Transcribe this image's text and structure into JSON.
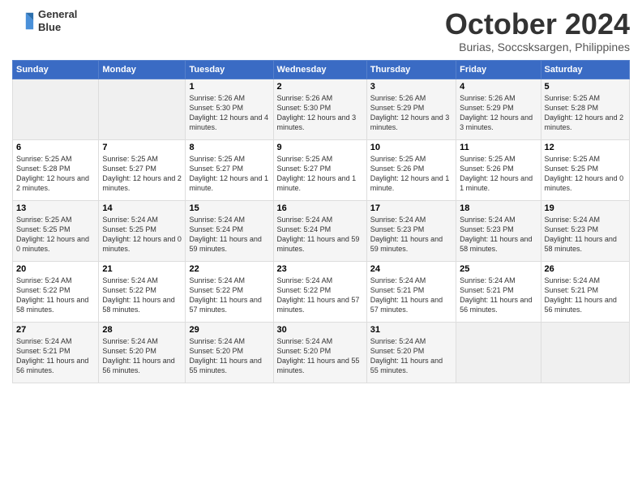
{
  "logo": {
    "line1": "General",
    "line2": "Blue"
  },
  "title": "October 2024",
  "subtitle": "Burias, Soccsksargen, Philippines",
  "headers": [
    "Sunday",
    "Monday",
    "Tuesday",
    "Wednesday",
    "Thursday",
    "Friday",
    "Saturday"
  ],
  "weeks": [
    [
      {
        "day": "",
        "empty": true
      },
      {
        "day": "",
        "empty": true
      },
      {
        "day": "1",
        "sunrise": "5:26 AM",
        "sunset": "5:30 PM",
        "daylight": "12 hours and 4 minutes."
      },
      {
        "day": "2",
        "sunrise": "5:26 AM",
        "sunset": "5:30 PM",
        "daylight": "12 hours and 3 minutes."
      },
      {
        "day": "3",
        "sunrise": "5:26 AM",
        "sunset": "5:29 PM",
        "daylight": "12 hours and 3 minutes."
      },
      {
        "day": "4",
        "sunrise": "5:26 AM",
        "sunset": "5:29 PM",
        "daylight": "12 hours and 3 minutes."
      },
      {
        "day": "5",
        "sunrise": "5:25 AM",
        "sunset": "5:28 PM",
        "daylight": "12 hours and 2 minutes."
      }
    ],
    [
      {
        "day": "6",
        "sunrise": "5:25 AM",
        "sunset": "5:28 PM",
        "daylight": "12 hours and 2 minutes."
      },
      {
        "day": "7",
        "sunrise": "5:25 AM",
        "sunset": "5:27 PM",
        "daylight": "12 hours and 2 minutes."
      },
      {
        "day": "8",
        "sunrise": "5:25 AM",
        "sunset": "5:27 PM",
        "daylight": "12 hours and 1 minute."
      },
      {
        "day": "9",
        "sunrise": "5:25 AM",
        "sunset": "5:27 PM",
        "daylight": "12 hours and 1 minute."
      },
      {
        "day": "10",
        "sunrise": "5:25 AM",
        "sunset": "5:26 PM",
        "daylight": "12 hours and 1 minute."
      },
      {
        "day": "11",
        "sunrise": "5:25 AM",
        "sunset": "5:26 PM",
        "daylight": "12 hours and 1 minute."
      },
      {
        "day": "12",
        "sunrise": "5:25 AM",
        "sunset": "5:25 PM",
        "daylight": "12 hours and 0 minutes."
      }
    ],
    [
      {
        "day": "13",
        "sunrise": "5:25 AM",
        "sunset": "5:25 PM",
        "daylight": "12 hours and 0 minutes."
      },
      {
        "day": "14",
        "sunrise": "5:24 AM",
        "sunset": "5:25 PM",
        "daylight": "12 hours and 0 minutes."
      },
      {
        "day": "15",
        "sunrise": "5:24 AM",
        "sunset": "5:24 PM",
        "daylight": "11 hours and 59 minutes."
      },
      {
        "day": "16",
        "sunrise": "5:24 AM",
        "sunset": "5:24 PM",
        "daylight": "11 hours and 59 minutes."
      },
      {
        "day": "17",
        "sunrise": "5:24 AM",
        "sunset": "5:23 PM",
        "daylight": "11 hours and 59 minutes."
      },
      {
        "day": "18",
        "sunrise": "5:24 AM",
        "sunset": "5:23 PM",
        "daylight": "11 hours and 58 minutes."
      },
      {
        "day": "19",
        "sunrise": "5:24 AM",
        "sunset": "5:23 PM",
        "daylight": "11 hours and 58 minutes."
      }
    ],
    [
      {
        "day": "20",
        "sunrise": "5:24 AM",
        "sunset": "5:22 PM",
        "daylight": "11 hours and 58 minutes."
      },
      {
        "day": "21",
        "sunrise": "5:24 AM",
        "sunset": "5:22 PM",
        "daylight": "11 hours and 58 minutes."
      },
      {
        "day": "22",
        "sunrise": "5:24 AM",
        "sunset": "5:22 PM",
        "daylight": "11 hours and 57 minutes."
      },
      {
        "day": "23",
        "sunrise": "5:24 AM",
        "sunset": "5:22 PM",
        "daylight": "11 hours and 57 minutes."
      },
      {
        "day": "24",
        "sunrise": "5:24 AM",
        "sunset": "5:21 PM",
        "daylight": "11 hours and 57 minutes."
      },
      {
        "day": "25",
        "sunrise": "5:24 AM",
        "sunset": "5:21 PM",
        "daylight": "11 hours and 56 minutes."
      },
      {
        "day": "26",
        "sunrise": "5:24 AM",
        "sunset": "5:21 PM",
        "daylight": "11 hours and 56 minutes."
      }
    ],
    [
      {
        "day": "27",
        "sunrise": "5:24 AM",
        "sunset": "5:21 PM",
        "daylight": "11 hours and 56 minutes."
      },
      {
        "day": "28",
        "sunrise": "5:24 AM",
        "sunset": "5:20 PM",
        "daylight": "11 hours and 56 minutes."
      },
      {
        "day": "29",
        "sunrise": "5:24 AM",
        "sunset": "5:20 PM",
        "daylight": "11 hours and 55 minutes."
      },
      {
        "day": "30",
        "sunrise": "5:24 AM",
        "sunset": "5:20 PM",
        "daylight": "11 hours and 55 minutes."
      },
      {
        "day": "31",
        "sunrise": "5:24 AM",
        "sunset": "5:20 PM",
        "daylight": "11 hours and 55 minutes."
      },
      {
        "day": "",
        "empty": true
      },
      {
        "day": "",
        "empty": true
      }
    ]
  ]
}
